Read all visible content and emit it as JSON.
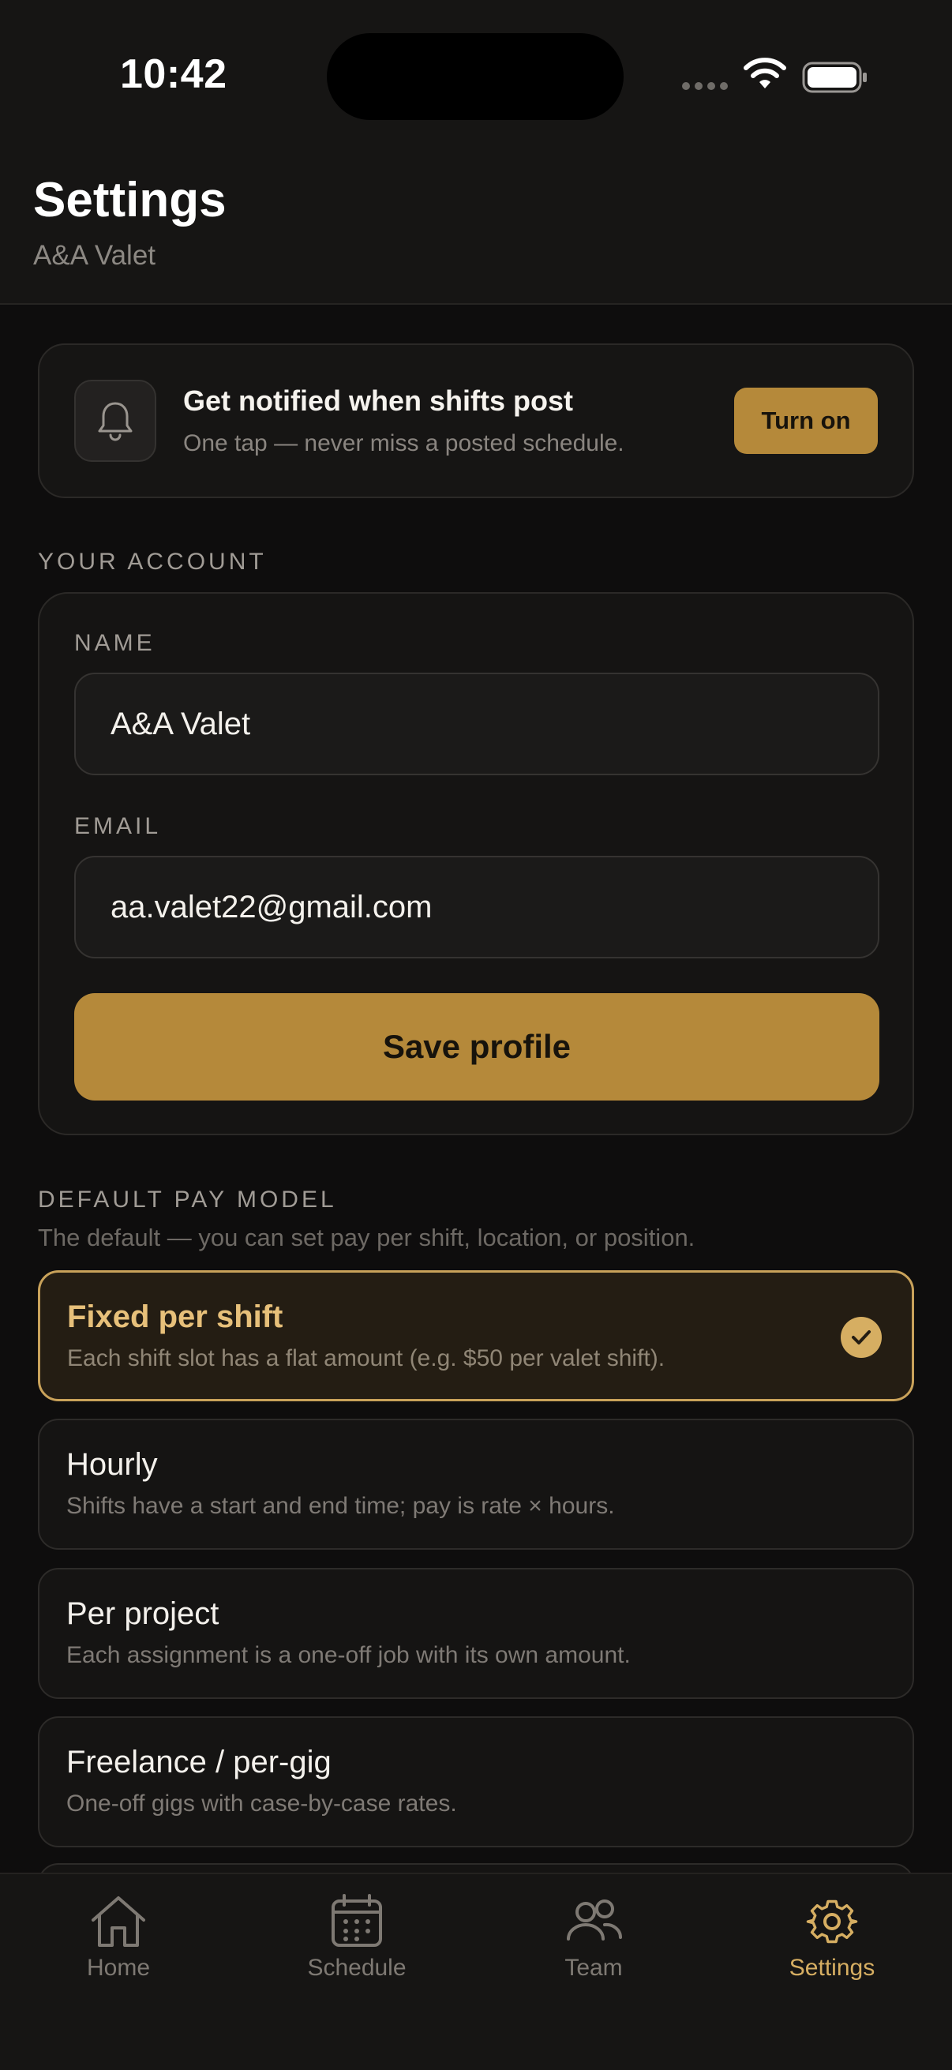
{
  "status_bar": {
    "time": "10:42"
  },
  "header": {
    "title": "Settings",
    "subtitle": "A&A Valet"
  },
  "notification": {
    "icon": "bell-icon",
    "title": "Get notified when shifts post",
    "subtitle": "One tap — never miss a posted schedule.",
    "button_label": "Turn on"
  },
  "account": {
    "section_label": "YOUR ACCOUNT",
    "name_label": "NAME",
    "name_value": "A&A Valet",
    "email_label": "EMAIL",
    "email_value": "aa.valet22@gmail.com",
    "save_label": "Save profile"
  },
  "pay_model": {
    "section_label": "DEFAULT PAY MODEL",
    "description": "The default — you can set pay per shift, location, or position.",
    "selected": "Fixed per shift",
    "options": [
      {
        "title": "Fixed per shift",
        "description": "Each shift slot has a flat amount (e.g. $50 per valet shift)."
      },
      {
        "title": "Hourly",
        "description": "Shifts have a start and end time; pay is rate × hours."
      },
      {
        "title": "Per project",
        "description": "Each assignment is a one-off job with its own amount."
      },
      {
        "title": "Freelance / per-gig",
        "description": "One-off gigs with case-by-case rates."
      }
    ]
  },
  "tab_bar": {
    "tabs": [
      {
        "label": "Home",
        "icon": "home-icon"
      },
      {
        "label": "Schedule",
        "icon": "calendar-icon"
      },
      {
        "label": "Team",
        "icon": "team-icon"
      },
      {
        "label": "Settings",
        "icon": "gear-icon"
      }
    ],
    "active": "Settings"
  },
  "colors": {
    "background": "#0e0d0d",
    "surface": "#151413",
    "accent": "#b5893a",
    "accent_text": "#d6ae62"
  }
}
